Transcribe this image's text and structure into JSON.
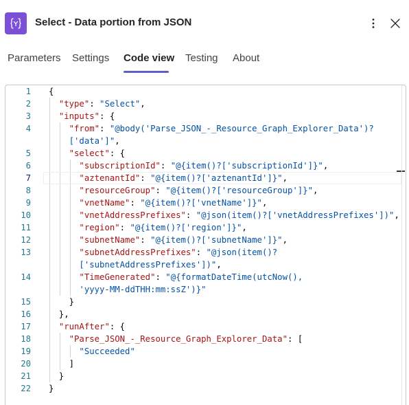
{
  "header": {
    "title": "Select - Data portion from JSON",
    "action_icon": "curly-braces-icon",
    "accent_color": "#7b4fd6",
    "more_icon": "more-vertical-icon",
    "close_icon": "close-icon"
  },
  "tabs": [
    {
      "label": "Parameters",
      "active": false
    },
    {
      "label": "Settings",
      "active": false
    },
    {
      "label": "Code view",
      "active": true
    },
    {
      "label": "Testing",
      "active": false
    },
    {
      "label": "About",
      "active": false
    }
  ],
  "editor": {
    "current_line": 7,
    "colors": {
      "key": "#a31515",
      "string": "#0451a5",
      "line_number": "#237893"
    },
    "lines": [
      {
        "number": "1",
        "tokens": [
          [
            "p",
            "{"
          ]
        ]
      },
      {
        "number": "2",
        "tokens": [
          [
            "p",
            "  "
          ],
          [
            "k",
            "\"type\""
          ],
          [
            "p",
            ": "
          ],
          [
            "s",
            "\"Select\""
          ],
          [
            "p",
            ","
          ]
        ]
      },
      {
        "number": "3",
        "tokens": [
          [
            "p",
            "  "
          ],
          [
            "k",
            "\"inputs\""
          ],
          [
            "p",
            ": {"
          ]
        ]
      },
      {
        "number": "4",
        "tokens": [
          [
            "p",
            "    "
          ],
          [
            "k",
            "\"from\""
          ],
          [
            "p",
            ": "
          ],
          [
            "s",
            "\"@body('Parse_JSON_-_Resource_Graph_Explorer_Data')?"
          ]
        ]
      },
      {
        "number": "",
        "tokens": [
          [
            "s",
            "    ['data']\""
          ],
          [
            "p",
            ","
          ]
        ]
      },
      {
        "number": "5",
        "tokens": [
          [
            "p",
            "    "
          ],
          [
            "k",
            "\"select\""
          ],
          [
            "p",
            ": {"
          ]
        ]
      },
      {
        "number": "6",
        "tokens": [
          [
            "p",
            "      "
          ],
          [
            "k",
            "\"subscriptionId\""
          ],
          [
            "p",
            ": "
          ],
          [
            "s",
            "\"@{item()?['subscriptionId']}\""
          ],
          [
            "p",
            ","
          ]
        ]
      },
      {
        "number": "7",
        "tokens": [
          [
            "p",
            "      "
          ],
          [
            "k",
            "\"aztenantId\""
          ],
          [
            "p",
            ": "
          ],
          [
            "s",
            "\"@{item()?['aztenantId']}\""
          ],
          [
            "p",
            ","
          ]
        ]
      },
      {
        "number": "8",
        "tokens": [
          [
            "p",
            "      "
          ],
          [
            "k",
            "\"resourceGroup\""
          ],
          [
            "p",
            ": "
          ],
          [
            "s",
            "\"@{item()?['resourceGroup']}\""
          ],
          [
            "p",
            ","
          ]
        ]
      },
      {
        "number": "9",
        "tokens": [
          [
            "p",
            "      "
          ],
          [
            "k",
            "\"vnetName\""
          ],
          [
            "p",
            ": "
          ],
          [
            "s",
            "\"@{item()?['vnetName']}\""
          ],
          [
            "p",
            ","
          ]
        ]
      },
      {
        "number": "10",
        "tokens": [
          [
            "p",
            "      "
          ],
          [
            "k",
            "\"vnetAddressPrefixes\""
          ],
          [
            "p",
            ": "
          ],
          [
            "s",
            "\"@json(item()?['vnetAddressPrefixes'])\""
          ],
          [
            "p",
            ","
          ]
        ]
      },
      {
        "number": "11",
        "tokens": [
          [
            "p",
            "      "
          ],
          [
            "k",
            "\"region\""
          ],
          [
            "p",
            ": "
          ],
          [
            "s",
            "\"@{item()?['region']}\""
          ],
          [
            "p",
            ","
          ]
        ]
      },
      {
        "number": "12",
        "tokens": [
          [
            "p",
            "      "
          ],
          [
            "k",
            "\"subnetName\""
          ],
          [
            "p",
            ": "
          ],
          [
            "s",
            "\"@{item()?['subnetName']}\""
          ],
          [
            "p",
            ","
          ]
        ]
      },
      {
        "number": "13",
        "tokens": [
          [
            "p",
            "      "
          ],
          [
            "k",
            "\"subnetAddressPrefixes\""
          ],
          [
            "p",
            ": "
          ],
          [
            "s",
            "\"@json(item()?"
          ]
        ]
      },
      {
        "number": "",
        "tokens": [
          [
            "s",
            "      ['subnetAddressPrefixes'])\""
          ],
          [
            "p",
            ","
          ]
        ]
      },
      {
        "number": "14",
        "tokens": [
          [
            "p",
            "      "
          ],
          [
            "k",
            "\"TimeGenerated\""
          ],
          [
            "p",
            ": "
          ],
          [
            "s",
            "\"@{formatDateTime(utcNow(),"
          ]
        ]
      },
      {
        "number": "",
        "tokens": [
          [
            "s",
            "      'yyyy-MM-ddTHH:mm:ssZ')}\""
          ]
        ]
      },
      {
        "number": "15",
        "tokens": [
          [
            "p",
            "    }"
          ]
        ]
      },
      {
        "number": "16",
        "tokens": [
          [
            "p",
            "  },"
          ]
        ]
      },
      {
        "number": "17",
        "tokens": [
          [
            "p",
            "  "
          ],
          [
            "k",
            "\"runAfter\""
          ],
          [
            "p",
            ": {"
          ]
        ]
      },
      {
        "number": "18",
        "tokens": [
          [
            "p",
            "    "
          ],
          [
            "k",
            "\"Parse_JSON_-_Resource_Graph_Explorer_Data\""
          ],
          [
            "p",
            ": ["
          ]
        ]
      },
      {
        "number": "19",
        "tokens": [
          [
            "p",
            "      "
          ],
          [
            "s",
            "\"Succeeded\""
          ]
        ]
      },
      {
        "number": "20",
        "tokens": [
          [
            "p",
            "    ]"
          ]
        ]
      },
      {
        "number": "21",
        "tokens": [
          [
            "p",
            "  }"
          ]
        ]
      },
      {
        "number": "22",
        "tokens": [
          [
            "p",
            "}"
          ]
        ]
      }
    ]
  }
}
